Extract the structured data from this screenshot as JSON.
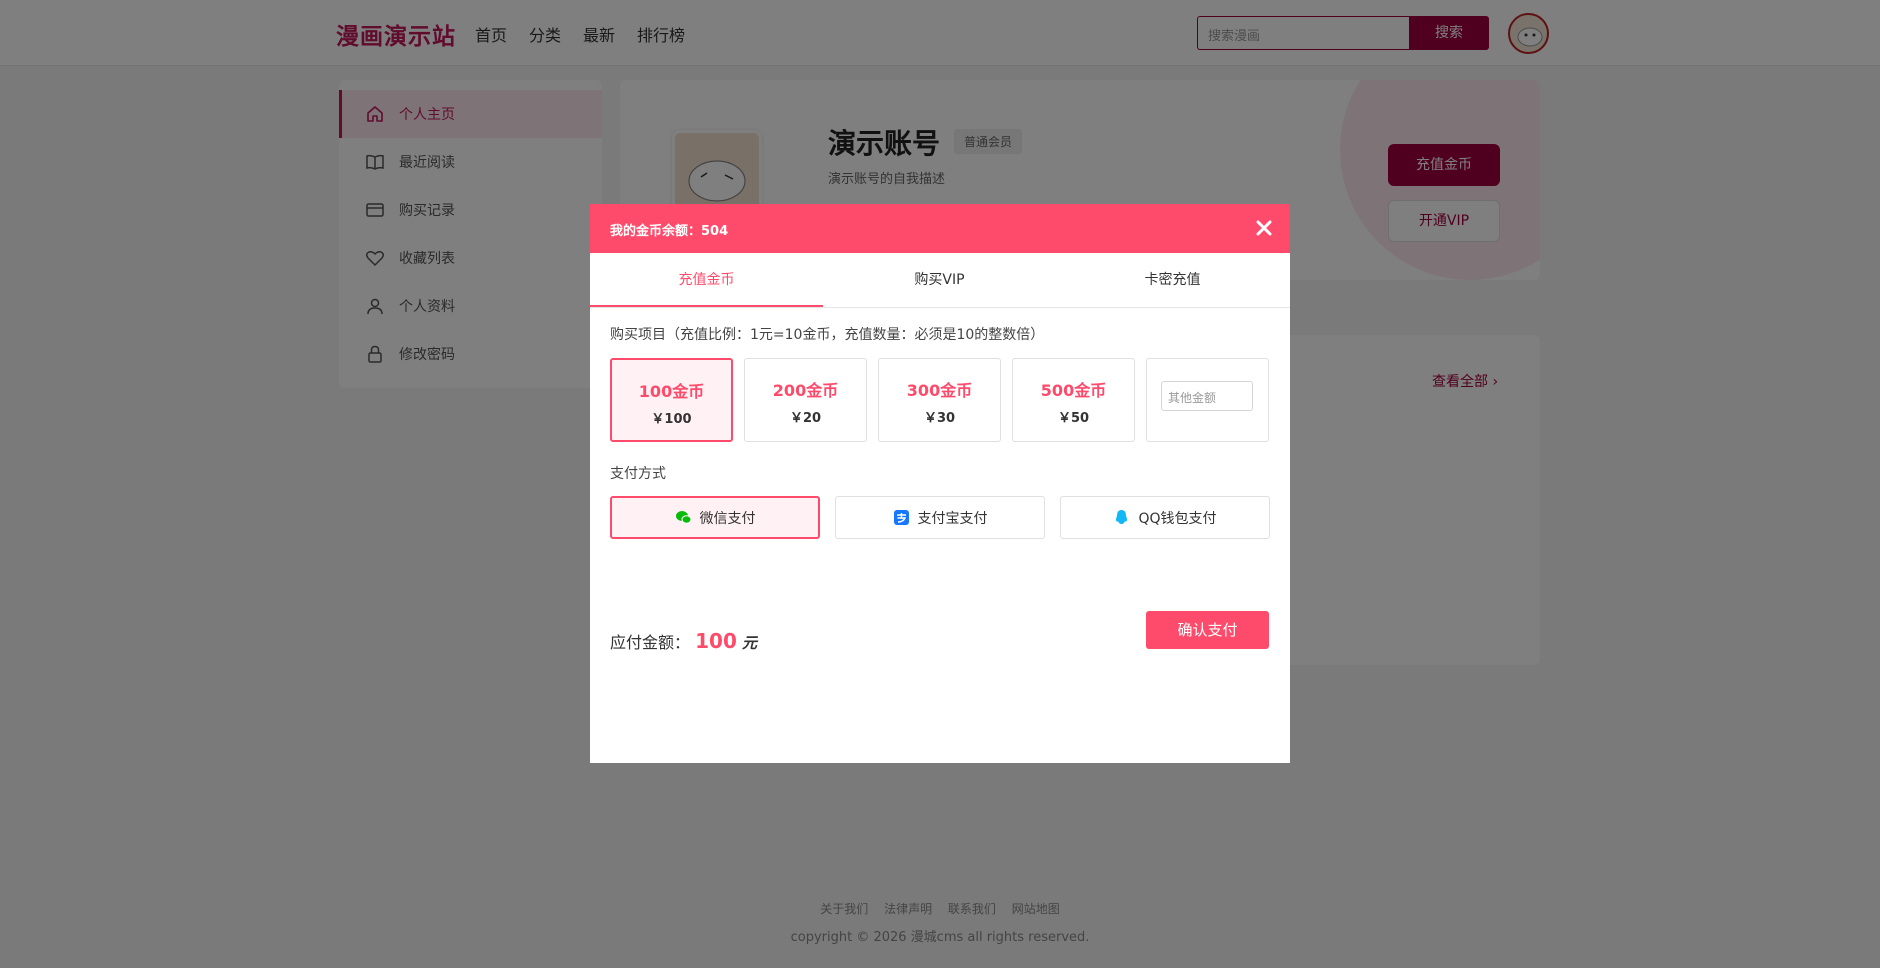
{
  "header": {
    "logo": "漫画演示站",
    "nav": [
      "首页",
      "分类",
      "最新",
      "排行榜"
    ],
    "search_placeholder": "搜索漫画",
    "search_button": "搜索"
  },
  "sidebar": {
    "items": [
      {
        "label": "个人主页",
        "icon": "home-icon"
      },
      {
        "label": "最近阅读",
        "icon": "book-icon"
      },
      {
        "label": "购买记录",
        "icon": "card-icon"
      },
      {
        "label": "收藏列表",
        "icon": "heart-icon"
      },
      {
        "label": "个人资料",
        "icon": "user-icon"
      },
      {
        "label": "修改密码",
        "icon": "lock-icon"
      }
    ]
  },
  "profile": {
    "name": "演示账号",
    "badge": "普通会员",
    "desc": "演示账号的自我描述",
    "recharge_button": "充值金币",
    "vip_button": "开通VIP",
    "view_all": "查看全部"
  },
  "footer": {
    "links": [
      "关于我们",
      "法律声明",
      "联系我们",
      "网站地图"
    ],
    "copyright": "copyright © 2026 漫城cms all rights reserved."
  },
  "modal": {
    "balance_label": "我的金币余额：504",
    "tabs": [
      "充值金币",
      "购买VIP",
      "卡密充值"
    ],
    "purchase_label": "购买项目（充值比例：1元=10金币，充值数量：必须是10的整数倍）",
    "packages": [
      {
        "coins": "100金币",
        "price": "￥100"
      },
      {
        "coins": "200金币",
        "price": "￥20"
      },
      {
        "coins": "300金币",
        "price": "￥30"
      },
      {
        "coins": "500金币",
        "price": "￥50"
      }
    ],
    "other_placeholder": "其他金额",
    "pay_label": "支付方式",
    "pay_methods": [
      "微信支付",
      "支付宝支付",
      "QQ钱包支付"
    ],
    "amount_label": "应付金额：",
    "amount_value": "100",
    "amount_unit": "元",
    "confirm_button": "确认支付"
  },
  "colors": {
    "brand": "#a0003c",
    "modal_accent": "#ff4b6b"
  }
}
